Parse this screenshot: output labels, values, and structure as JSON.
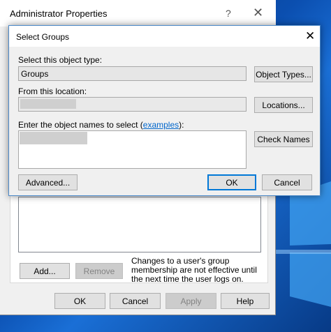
{
  "background_dialog": {
    "title": "Administrator Properties",
    "help_glyph": "?",
    "close_glyph": "✕",
    "add_label": "Add...",
    "remove_label": "Remove",
    "note": "Changes to a user's group membership are not effective until the next time the user logs on.",
    "ok_label": "OK",
    "cancel_label": "Cancel",
    "apply_label": "Apply",
    "help_label": "Help"
  },
  "select_groups": {
    "title": "Select Groups",
    "close_glyph": "✕",
    "object_type_label": "Select this object type:",
    "object_type_value": "Groups",
    "object_types_button": "Object Types...",
    "location_label": "From this location:",
    "locations_button": "Locations...",
    "names_label_prefix": "Enter the object names to select (",
    "names_label_link": "examples",
    "names_label_suffix": "):",
    "check_names_button": "Check Names",
    "advanced_button": "Advanced...",
    "ok_button": "OK",
    "cancel_button": "Cancel"
  },
  "colors": {
    "accent": "#0078d7",
    "link": "#0066cc",
    "dialog_bg": "#f0f0f0"
  }
}
